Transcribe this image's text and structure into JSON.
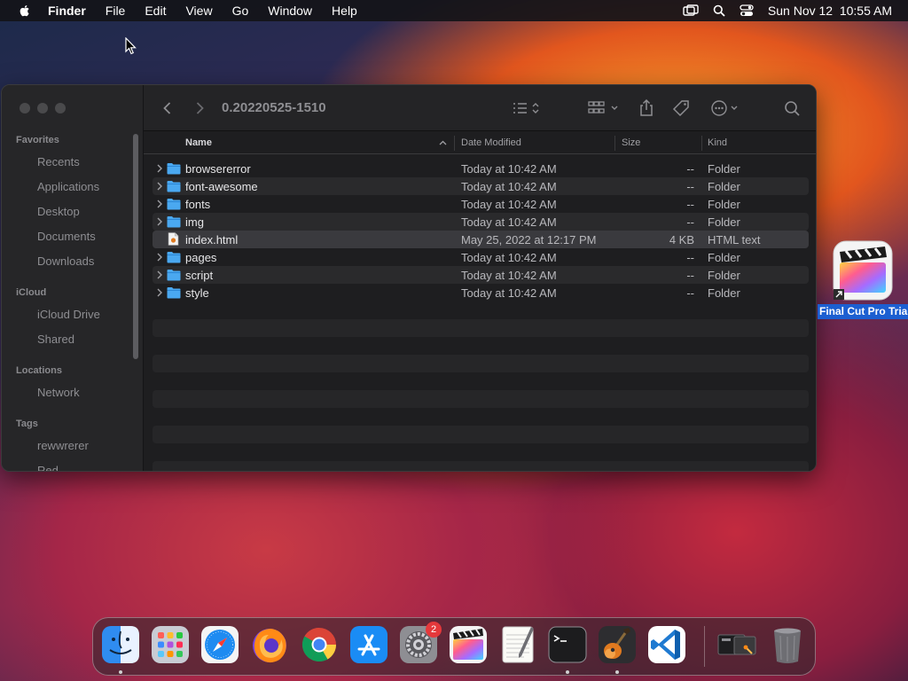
{
  "menubar": {
    "app_name": "Finder",
    "menus": [
      "File",
      "Edit",
      "View",
      "Go",
      "Window",
      "Help"
    ],
    "clock": "Sun Nov 12  10:55 AM"
  },
  "window": {
    "title": "0.20220525-1510",
    "sidebar": {
      "favorites_header": "Favorites",
      "favorites": [
        "Recents",
        "Applications",
        "Desktop",
        "Documents",
        "Downloads"
      ],
      "icloud_header": "iCloud",
      "icloud": [
        "iCloud Drive",
        "Shared"
      ],
      "locations_header": "Locations",
      "locations": [
        "Network"
      ],
      "tags_header": "Tags",
      "tags": [
        "rewwrerer",
        "Red"
      ]
    },
    "columns": {
      "name": "Name",
      "date": "Date Modified",
      "size": "Size",
      "kind": "Kind"
    },
    "rows": [
      {
        "name": "browsererror",
        "date": "Today at 10:42 AM",
        "size": "--",
        "kind": "Folder",
        "type": "folder"
      },
      {
        "name": "font-awesome",
        "date": "Today at 10:42 AM",
        "size": "--",
        "kind": "Folder",
        "type": "folder"
      },
      {
        "name": "fonts",
        "date": "Today at 10:42 AM",
        "size": "--",
        "kind": "Folder",
        "type": "folder"
      },
      {
        "name": "img",
        "date": "Today at 10:42 AM",
        "size": "--",
        "kind": "Folder",
        "type": "folder"
      },
      {
        "name": "index.html",
        "date": "May 25, 2022 at 12:17 PM",
        "size": "4 KB",
        "kind": "HTML text",
        "type": "file"
      },
      {
        "name": "pages",
        "date": "Today at 10:42 AM",
        "size": "--",
        "kind": "Folder",
        "type": "folder"
      },
      {
        "name": "script",
        "date": "Today at 10:42 AM",
        "size": "--",
        "kind": "Folder",
        "type": "folder"
      },
      {
        "name": "style",
        "date": "Today at 10:42 AM",
        "size": "--",
        "kind": "Folder",
        "type": "folder"
      }
    ]
  },
  "desktop": {
    "item_label": "Final Cut Pro Trial"
  },
  "dock": {
    "apps": [
      "finder-icon",
      "launchpad-icon",
      "safari-icon",
      "firefox-icon",
      "chrome-icon",
      "app-store-icon",
      "system-settings-icon",
      "final-cut-pro-icon",
      "textedit-icon",
      "terminal-icon",
      "garageband-icon",
      "vscode-icon",
      "screenshot-folder-icon",
      "trash-icon"
    ],
    "settings_badge": "2"
  },
  "colors": {
    "folder_blue": "#4aa8f0",
    "selection_blue": "#1c5fd1",
    "badge_red": "#e5383b"
  }
}
